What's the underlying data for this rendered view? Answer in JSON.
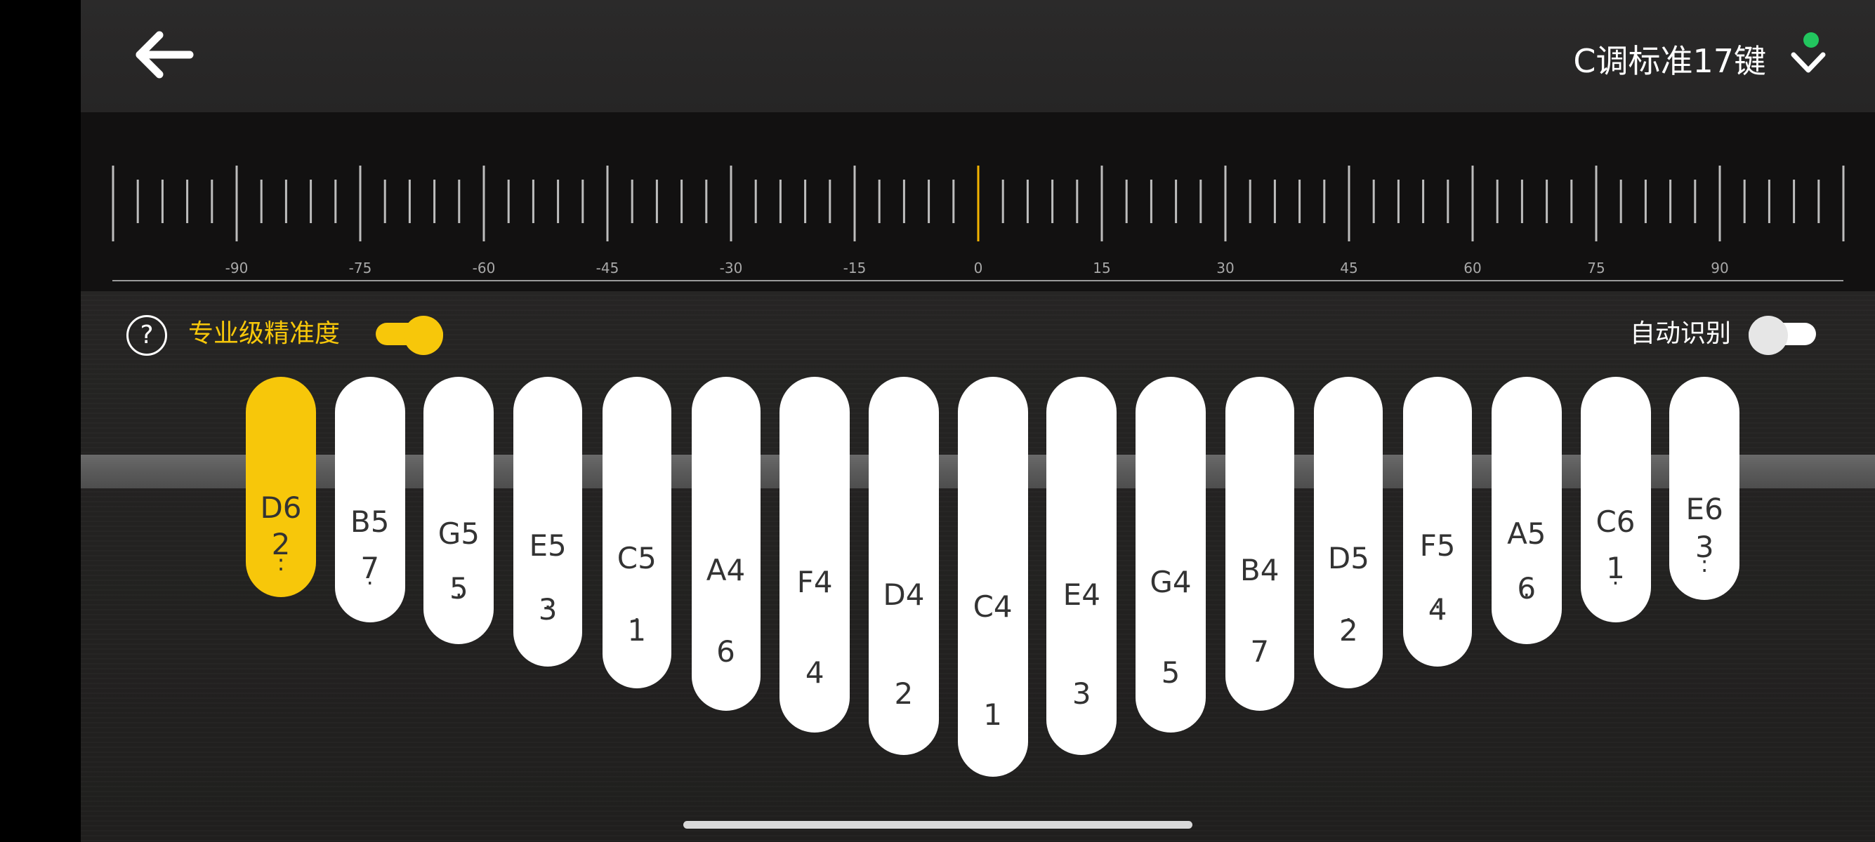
{
  "header": {
    "title": "C调标准17键",
    "back_icon": "arrow-left-icon",
    "dropdown_icon": "chevron-down-icon",
    "status_color": "#22c55e"
  },
  "tuner": {
    "scale_labels": [
      "-90",
      "-75",
      "-60",
      "-45",
      "-30",
      "-15",
      "0",
      "15",
      "30",
      "45",
      "60",
      "75",
      "90"
    ],
    "current_value": 0,
    "indicator_color": "#f4b400"
  },
  "controls": {
    "help_symbol": "?",
    "precision_label": "专业级精准度",
    "precision_enabled": true,
    "auto_label": "自动识别",
    "auto_enabled": false,
    "accent_color": "#f7c70a"
  },
  "keys": [
    {
      "note": "D6",
      "dots": ":",
      "num": "2",
      "active": true
    },
    {
      "note": "B5",
      "dots": ".",
      "num": "7",
      "active": false
    },
    {
      "note": "G5",
      "dots": ".",
      "num": "5",
      "active": false
    },
    {
      "note": "E5",
      "dots": ".",
      "num": "3",
      "active": false
    },
    {
      "note": "C5",
      "dots": ".",
      "num": "1",
      "active": false
    },
    {
      "note": "A4",
      "dots": "",
      "num": "6",
      "active": false
    },
    {
      "note": "F4",
      "dots": "",
      "num": "4",
      "active": false
    },
    {
      "note": "D4",
      "dots": "",
      "num": "2",
      "active": false
    },
    {
      "note": "C4",
      "dots": "",
      "num": "1",
      "active": false
    },
    {
      "note": "E4",
      "dots": "",
      "num": "3",
      "active": false
    },
    {
      "note": "G4",
      "dots": "",
      "num": "5",
      "active": false
    },
    {
      "note": "B4",
      "dots": "",
      "num": "7",
      "active": false
    },
    {
      "note": "D5",
      "dots": ".",
      "num": "2",
      "active": false
    },
    {
      "note": "F5",
      "dots": ".",
      "num": "4",
      "active": false
    },
    {
      "note": "A5",
      "dots": ".",
      "num": "6",
      "active": false
    },
    {
      "note": "C6",
      "dots": ".",
      "num": "1",
      "active": false
    },
    {
      "note": "E6",
      "dots": ":",
      "num": "3",
      "active": false
    }
  ]
}
